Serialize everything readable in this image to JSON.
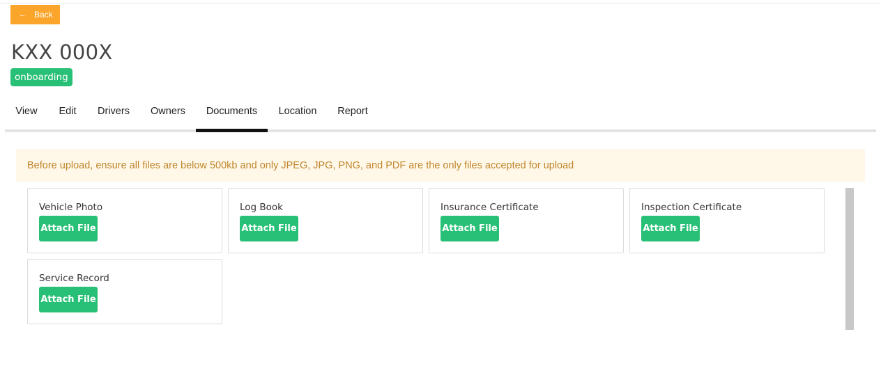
{
  "header": {
    "back_label": "Back",
    "back_icon": "arrow-left-icon",
    "title": "KXX 000X",
    "status": "onboarding"
  },
  "tabs": [
    {
      "label": "View"
    },
    {
      "label": "Edit"
    },
    {
      "label": "Drivers"
    },
    {
      "label": "Owners"
    },
    {
      "label": "Documents",
      "active": true
    },
    {
      "label": "Location"
    },
    {
      "label": "Report"
    }
  ],
  "alert": {
    "text": "Before upload, ensure all files are below 500kb and only JPEG, JPG, PNG, and PDF are the only files accepted for upload"
  },
  "documents": [
    {
      "label": "Vehicle Photo",
      "button": "Attach File"
    },
    {
      "label": "Log Book",
      "button": "Attach File"
    },
    {
      "label": "Insurance Certificate",
      "button": "Attach File"
    },
    {
      "label": "Inspection Certificate",
      "button": "Attach File"
    },
    {
      "label": "Service Record",
      "button": "Attach File"
    }
  ],
  "colors": {
    "back_button": "#fba52a",
    "success": "#28c076",
    "alert_bg": "#fff8e9",
    "alert_text": "#c0852a"
  }
}
